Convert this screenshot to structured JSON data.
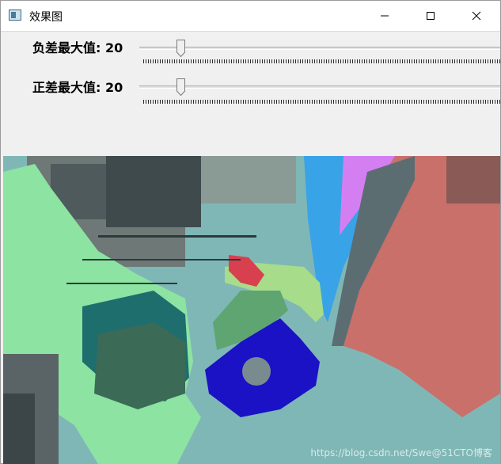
{
  "window": {
    "title": "效果图",
    "icon": "app-window-icon",
    "buttons": [
      "minimize-icon",
      "maximize-icon",
      "close-icon"
    ]
  },
  "trackbars": [
    {
      "label": "负差最大值: 20",
      "value": 20
    },
    {
      "label": "正差最大值: 20",
      "value": 20
    }
  ],
  "image": {
    "watermark": "https://blog.csdn.net/Swe@51CTO博客"
  },
  "colors": {
    "base": "#7fb7b6",
    "green": "#8de3a2",
    "blue": "#1a12c4",
    "magenta": "#d37ff2",
    "sky": "#39a3e8",
    "salmon": "#c9706b",
    "red": "#d8404f",
    "lightgreen": "#a7dc8a"
  }
}
